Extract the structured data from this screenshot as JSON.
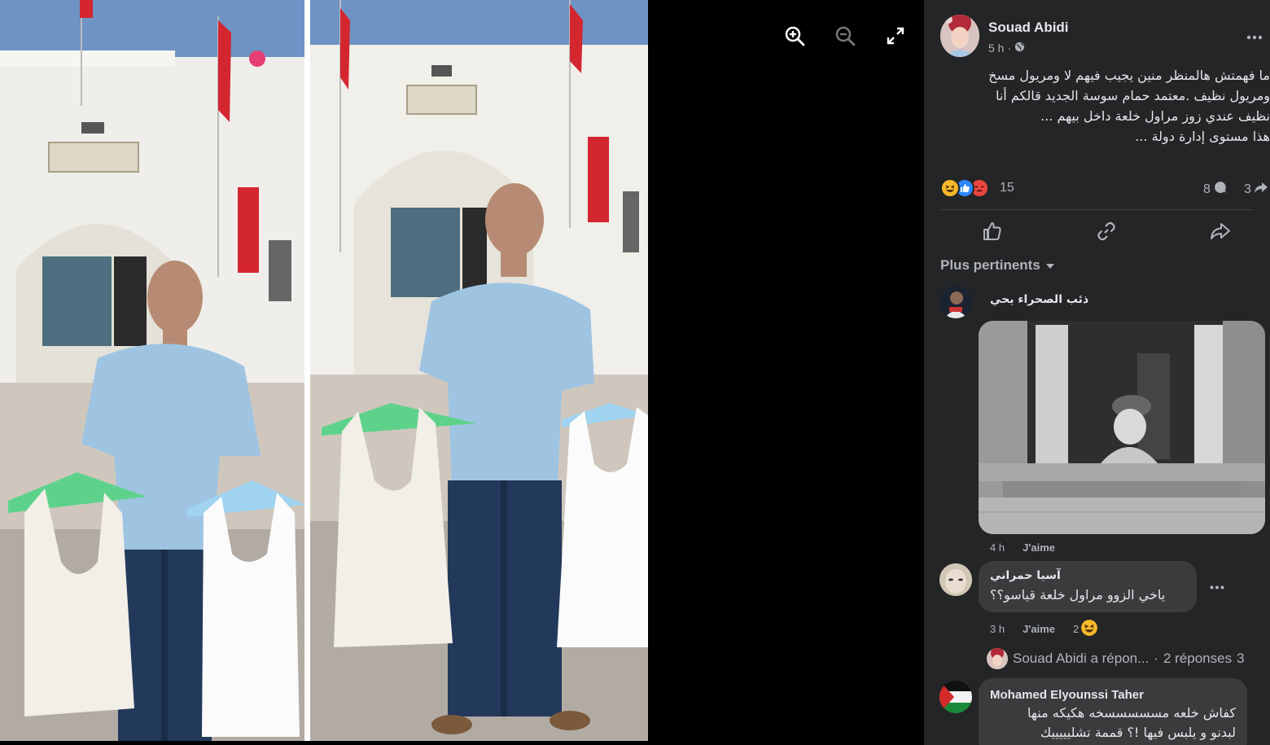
{
  "viewer": {
    "tools": [
      "zoom-in-icon",
      "zoom-out-icon",
      "fullscreen-icon"
    ]
  },
  "post": {
    "author": "Souad Abidi",
    "time": "5 h",
    "privacy_separator": "·",
    "privacy_icon": "globe-icon",
    "text_lines": [
      "ما فهمتش هالمنظر منين يجيب فيهم لا ومريول مسخ",
      "ومريول نظيف .معتمد حمام سوسة الجديد قالكم أنا",
      "نظيف عندي زوز مراول خلعة داخل بيهم ...",
      "هذا مستوى إدارة دولة ..."
    ],
    "reactions": {
      "icons": [
        "haha-icon",
        "like-icon",
        "angry-icon"
      ],
      "count": "15",
      "comments": "8",
      "shares": "3"
    },
    "actions": [
      "like-button",
      "copy-link-button",
      "share-button"
    ]
  },
  "comments": {
    "filter_label": "Plus pertinents",
    "items": [
      {
        "author": "ذئب الصحراء يحي",
        "time": "4 h",
        "like_label": "J'aime",
        "has_gif": true
      },
      {
        "author": "آسيا حمراني",
        "text": "ياخي الزوو مراول خلعة قياسو؟؟",
        "time": "3 h",
        "like_label": "J'aime",
        "reaction_count": "2",
        "reaction_icon": "haha-icon"
      },
      {
        "author": "Mohamed Elyounssi Taher",
        "text_lines": [
          "كفاش خلعه مسسسسسخه هكيكه منها",
          "لبدنو و يلبس فيها !؟ قممة تشليييييك"
        ]
      }
    ],
    "replies": {
      "author": "Souad Abidi a répon...",
      "separator": "·",
      "count_label": "2 réponses",
      "trailing": "3"
    }
  },
  "colors": {
    "panel_bg": "#242526",
    "bubble_bg": "#3a3b3c",
    "text_primary": "#e4e6eb",
    "text_secondary": "#b0b3b8",
    "like_blue": "#2d88ff",
    "angry_red": "#e9473f",
    "haha_yellow": "#f7b928"
  }
}
